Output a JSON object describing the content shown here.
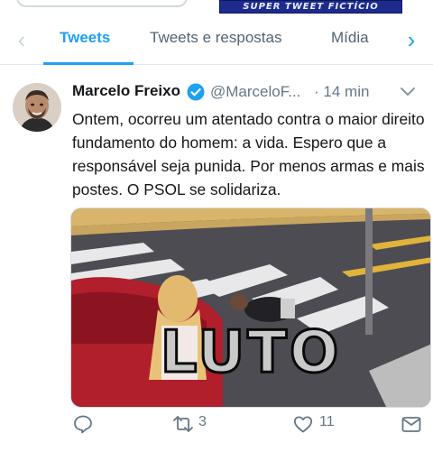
{
  "app": {
    "watermark": "SUPER TWEET FICTÍCIO"
  },
  "tabs": [
    {
      "label": "Tweets",
      "active": true
    },
    {
      "label": "Tweets e respostas",
      "active": false
    },
    {
      "label": "Mídia",
      "active": false
    }
  ],
  "tweet": {
    "author_name": "Marcelo Freixo",
    "verified": true,
    "handle": "@MarceloF...",
    "separator": "·",
    "time": "14 min",
    "text": "Ontem, ocorreu um atentado contra o maior direito fundamento do homem: a vida. Espero que a responsável seja punida. Por menos armas e mais postes. O PSOL se solidariza.",
    "media_caption": "LUTO",
    "actions": {
      "reply_count": "",
      "retweet_count": "3",
      "like_count": "11"
    }
  },
  "colors": {
    "accent": "#1da1f2",
    "text": "#14171a",
    "muted": "#657786",
    "watermark_bg": "#1d2b8c"
  },
  "icons": {
    "tab_prev": "chevron-left-icon",
    "tab_next": "chevron-right-icon",
    "verified": "verified-badge-icon",
    "menu": "chevron-down-icon",
    "reply": "reply-icon",
    "retweet": "retweet-icon",
    "like": "heart-icon",
    "dm": "envelope-icon"
  }
}
